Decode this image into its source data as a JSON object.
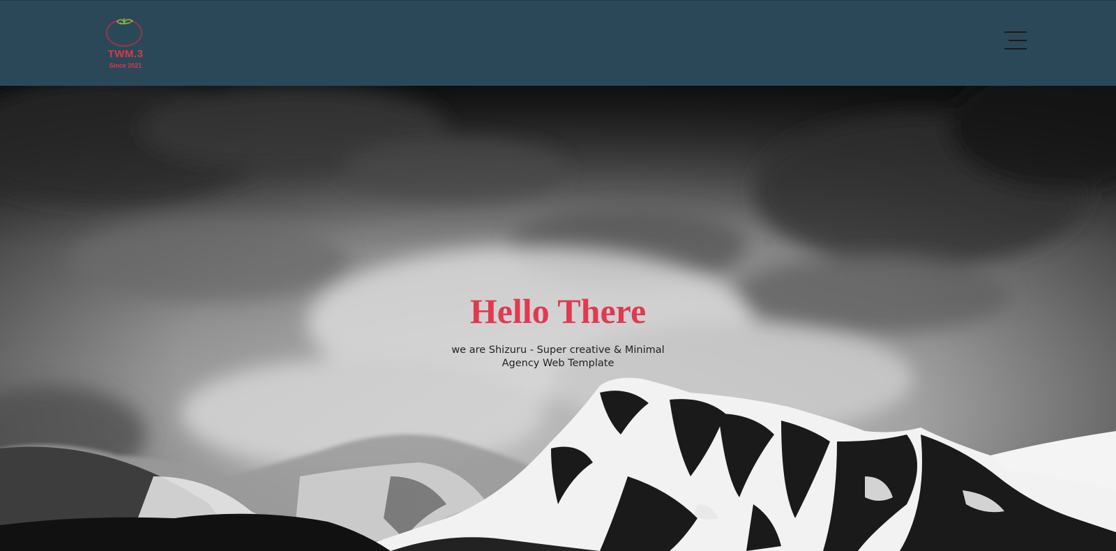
{
  "header": {
    "logo": {
      "icon": "tomato-icon",
      "wordmark": "TWM.3",
      "tagline": "Since 2021"
    },
    "menu_icon": "hamburger-menu-icon"
  },
  "hero": {
    "background": "black-and-white snowy mountain under clouds",
    "title": "Hello There",
    "subtitle": "we are Shizuru - Super creative & Minimal Agency Web Template"
  },
  "colors": {
    "header_bg": "#2b4858",
    "accent": "#e03a4e",
    "logo_red": "#d63a4a",
    "logo_leaf": "#7fbf4a"
  }
}
